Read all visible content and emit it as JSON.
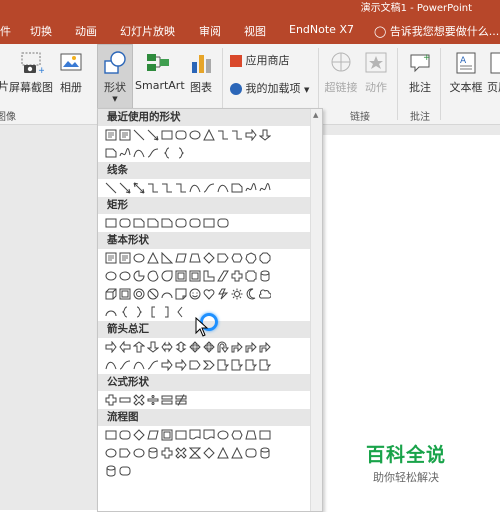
{
  "title": "演示文稿1 - PowerPoint",
  "tabs": [
    "件",
    "切换",
    "动画",
    "幻灯片放映",
    "审阅",
    "视图",
    "EndNote X7"
  ],
  "tell_me": "告诉我您想要做什么...",
  "ribbon": {
    "buttons": {
      "screenshot_prefix": "片",
      "screenshot": "屏幕截图",
      "album": "相册",
      "shapes": "形状",
      "smartart": "SmartArt",
      "chart": "图表",
      "store": "应用商店",
      "my_addins": "我的加载项",
      "hyperlink": "超链接",
      "action": "动作",
      "comment": "批注",
      "textbox": "文本框",
      "header": "页眉"
    },
    "groups": {
      "images": "图像",
      "links": "链接",
      "comments": "批注"
    }
  },
  "gallery": {
    "categories": {
      "recent": "最近使用的形状",
      "lines": "线条",
      "rect": "矩形",
      "basic": "基本形状",
      "arrows": "箭头总汇",
      "equation": "公式形状",
      "flowchart": "流程图"
    }
  },
  "watermark": {
    "main": "百科全说",
    "sub": "助你轻松解决"
  },
  "colors": {
    "accent": "#b7472a",
    "watermark": "#19a34a",
    "hover_ring": "#1e90ff"
  }
}
